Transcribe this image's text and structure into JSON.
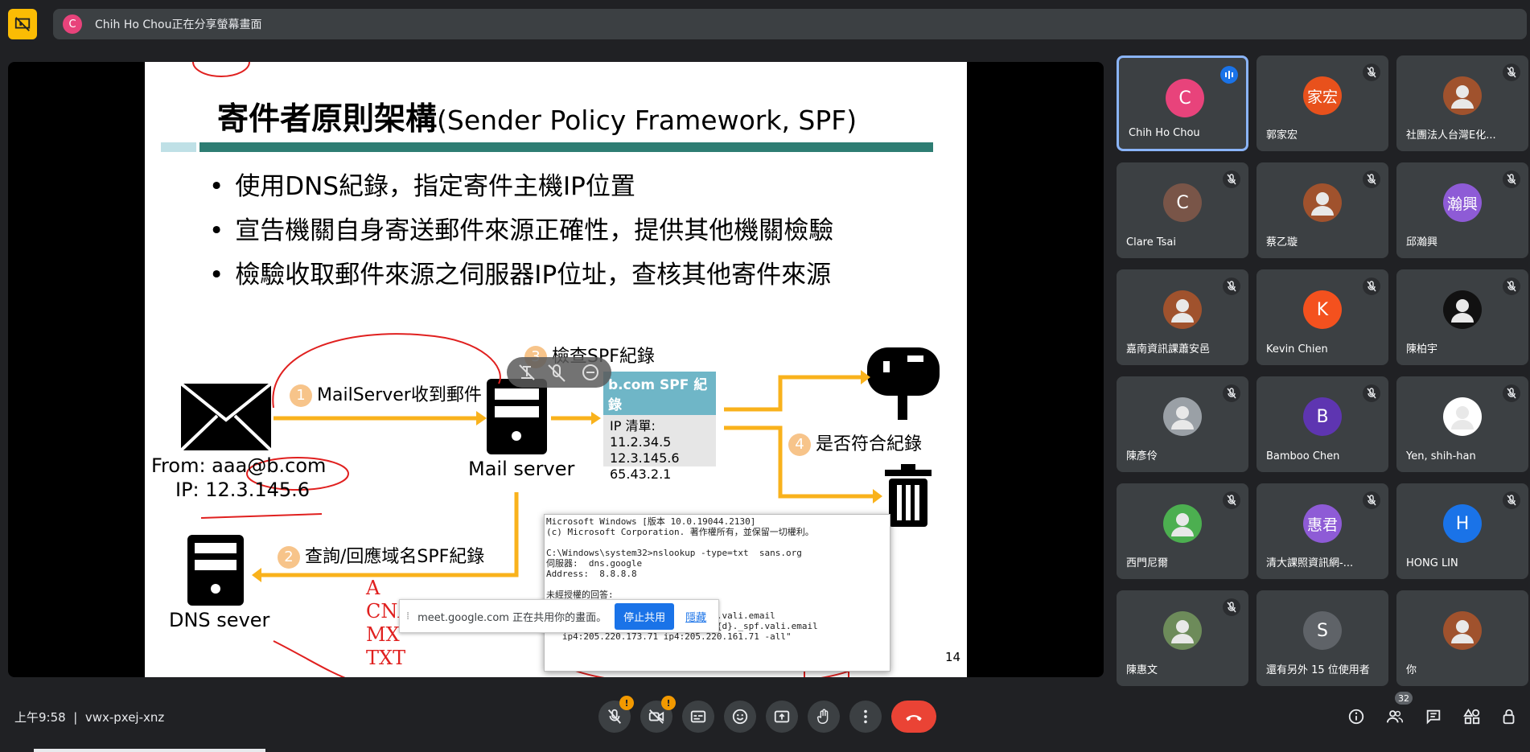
{
  "topbar": {
    "presenter_initial": "C",
    "share_text": "Chih Ho Chou正在分享螢幕畫面"
  },
  "slide": {
    "title_zh": "寄件者原則架構",
    "title_en": "(Sender Policy Framework, SPF)",
    "bullets": [
      "使用DNS紀錄，指定寄件主機IP位置",
      "宣告機關自身寄送郵件來源正確性，提供其他機關檢驗",
      "檢驗收取郵件來源之伺服器IP位址，查核其他寄件來源"
    ],
    "step1": "MailServer收到郵件",
    "step2": "查詢/回應域名SPF紀錄",
    "step3": "檢查SPF紀錄",
    "step4": "是否符合紀錄",
    "n1": "1",
    "n2": "2",
    "n3": "3",
    "n4": "4",
    "from": "From: aaa@b.com",
    "ip": "IP: 12.3.145.6",
    "mail_server": "Mail server",
    "dns_server": "DNS sever",
    "spf_head": "b.com SPF 紀錄",
    "spf_lines": [
      "IP 清單:",
      "11.2.34.5",
      "12.3.145.6",
      "65.43.2.1"
    ],
    "cmd_text": "Microsoft Windows [版本 10.0.19044.2130]\n(c) Microsoft Corporation. 著作權所有，並保留一切權利。\n\nC:\\Windows\\system32>nslookup -type=txt  sans.org\n伺服器:  dns.google\nAddress:  8.8.8.8\n\n未經授權的回答:\n\n   v=spf1 include:sans.org. nspf.vali.email\n   include:%{i}._ip.%{h}._ehlo.%{d}._spf.vali.email\n   ip4:205.220.173.71 ip4:205.220.161.71 -all\"",
    "page": "14",
    "handwriting": "A\nCNA\nMX\nTXT"
  },
  "share_banner": {
    "message": "meet.google.com 正在共用你的畫面。",
    "stop": "停止共用",
    "hide": "隱藏"
  },
  "participants": [
    {
      "name": "Chih Ho Chou",
      "initial": "C",
      "color": "#e8437b",
      "active": true
    },
    {
      "name": "郭家宏",
      "initial": "家宏",
      "color": "#e8511c"
    },
    {
      "name": "社團法人台灣E化...",
      "initial": "",
      "color": "#a0522d"
    },
    {
      "name": "Clare Tsai",
      "initial": "C",
      "color": "#795548"
    },
    {
      "name": "蔡乙璇",
      "initial": "",
      "color": "#a0522d"
    },
    {
      "name": "邱瀚興",
      "initial": "瀚興",
      "color": "#8e5bd6"
    },
    {
      "name": "嘉南資訊課蕭安邑",
      "initial": "",
      "color": "#a0522d"
    },
    {
      "name": "Kevin Chien",
      "initial": "K",
      "color": "#f4511e"
    },
    {
      "name": "陳柏宇",
      "initial": "",
      "color": "#111"
    },
    {
      "name": "陳彥伶",
      "initial": "",
      "color": "#9aa0a6"
    },
    {
      "name": "Bamboo Chen",
      "initial": "B",
      "color": "#5e35b1"
    },
    {
      "name": "Yen, shih-han",
      "initial": "",
      "color": "#fff"
    },
    {
      "name": "西門尼爾",
      "initial": "",
      "color": "#4caf50"
    },
    {
      "name": "清大課照資訊網-...",
      "initial": "惠君",
      "color": "#8e5bd6"
    },
    {
      "name": "HONG LIN",
      "initial": "H",
      "color": "#1a73e8"
    },
    {
      "name": "陳惠文",
      "initial": "",
      "color": "#6d8b5a"
    },
    {
      "name": "還有另外 15 位使用者",
      "initial": "S",
      "color": "#5f6368"
    },
    {
      "name": "你",
      "initial": "",
      "color": "#a0522d"
    }
  ],
  "bottom": {
    "time": "上午9:58",
    "meeting_code": "vwx-pxej-xnz",
    "people_count": "32",
    "badge": "!"
  }
}
